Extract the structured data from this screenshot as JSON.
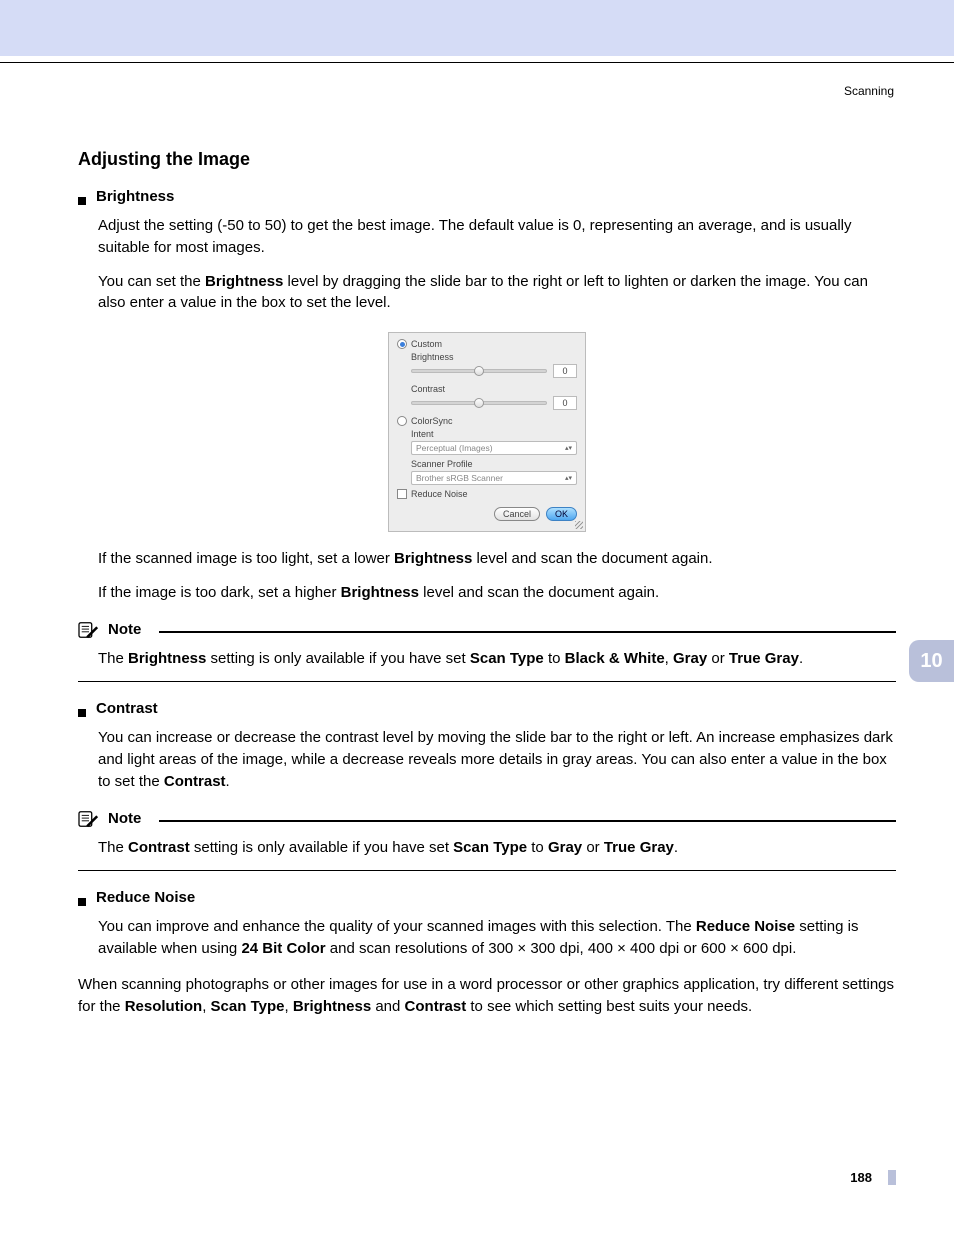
{
  "header": {
    "section_label": "Scanning"
  },
  "title": "Adjusting the Image",
  "brightness": {
    "heading": "Brightness",
    "p1_a": "Adjust the setting (-50 to 50) to get the best image. The default value is 0, representing an average, and is usually suitable for most images.",
    "p2_a": "You can set the ",
    "p2_b": "Brightness",
    "p2_c": " level by dragging the slide bar to the right or left to lighten or darken the image. You can also enter a value in the box to set the level.",
    "after1_a": "If the scanned image is too light, set a lower ",
    "after1_b": "Brightness",
    "after1_c": " level and scan the document again.",
    "after2_a": "If the image is too dark, set a higher ",
    "after2_b": "Brightness",
    "after2_c": " level and scan the document again."
  },
  "figure": {
    "custom": "Custom",
    "brightness_lbl": "Brightness",
    "brightness_val": "0",
    "contrast_lbl": "Contrast",
    "contrast_val": "0",
    "colorsync": "ColorSync",
    "intent": "Intent",
    "intent_val": "Perceptual (Images)",
    "scanner_profile": "Scanner Profile",
    "scanner_profile_val": "Brother sRGB Scanner",
    "reduce_noise": "Reduce Noise",
    "cancel": "Cancel",
    "ok": "OK"
  },
  "note1": {
    "title": "Note",
    "b1": "The ",
    "b2": "Brightness",
    "b3": " setting is only available if you have set ",
    "b4": "Scan Type",
    "b5": " to ",
    "b6": "Black & White",
    "b7": ", ",
    "b8": "Gray",
    "b9": " or ",
    "b10": "True Gray",
    "b11": "."
  },
  "contrast": {
    "heading": "Contrast",
    "p_a": "You can increase or decrease the contrast level by moving the slide bar to the right or left. An increase emphasizes dark and light areas of the image, while a decrease reveals more details in gray areas. You can also enter a value in the box to set the ",
    "p_b": "Contrast",
    "p_c": "."
  },
  "note2": {
    "title": "Note",
    "b1": "The ",
    "b2": "Contrast",
    "b3": " setting is only available if you have set ",
    "b4": "Scan Type",
    "b5": " to ",
    "b6": "Gray",
    "b7": " or ",
    "b8": "True Gray",
    "b9": "."
  },
  "reduce_noise": {
    "heading": "Reduce Noise",
    "p_a": "You can improve and enhance the quality of your scanned images with this selection. The ",
    "p_b": "Reduce Noise",
    "p_c": " setting is available when using ",
    "p_d": "24 Bit Color",
    "p_e": " and scan resolutions of 300 × 300 dpi, 400 × 400 dpi or 600 × 600 dpi."
  },
  "closing": {
    "a": "When scanning photographs or other images for use in a word processor or other graphics application, try different settings for the ",
    "b": "Resolution",
    "c": ", ",
    "d": "Scan Type",
    "e": ", ",
    "f": "Brightness",
    "g": " and ",
    "h": "Contrast",
    "i": " to see which setting best suits your needs."
  },
  "chapter": "10",
  "page_number": "188"
}
